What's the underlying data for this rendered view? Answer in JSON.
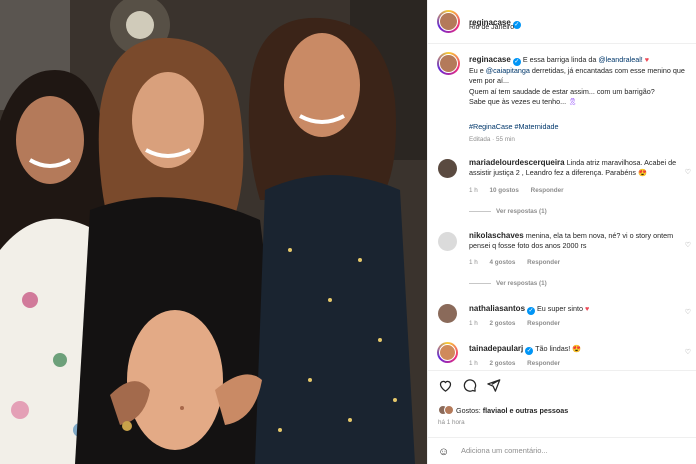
{
  "post": {
    "username": "reginacase",
    "location": "Rio de Janeiro"
  },
  "caption": {
    "username": "reginacase",
    "line1_pre": "E essa barriga linda da ",
    "mention1": "@leandraleal!",
    "line2_pre": "Eu e ",
    "mention2": "@caiapitanga",
    "line2_post": " derretidas, já encantadas com esse menino que vem por aí...",
    "line3": "Quem aí tem saudade de estar assim... com um barrigão?",
    "line4": "Sabe que às vezes eu tenho...",
    "hashtags": "#ReginaCase #Maternidade",
    "meta": "Editada · 55 min"
  },
  "comments": [
    {
      "username": "mariadelourdescerqueira",
      "text": "Linda atriz maravilhosa. Acabei de assistir justiça 2 , Leandro fez a diferença. Parabéns",
      "time": "1 h",
      "likes": "10 gostos",
      "reply": "Responder",
      "replies": "Ver respostas (1)"
    },
    {
      "username": "nikolaschaves",
      "text": "menina, ela ta bem nova, né? vi o story ontem pensei q fosse foto dos anos 2000 rs",
      "time": "1 h",
      "likes": "4 gostos",
      "reply": "Responder",
      "replies": "Ver respostas (1)"
    },
    {
      "username": "nathaliasantos",
      "text": "Eu super sinto",
      "time": "1 h",
      "likes": "2 gostos",
      "reply": "Responder"
    },
    {
      "username": "tainadepaularj",
      "text": "Tão lindas!",
      "time": "1 h",
      "likes": "2 gostos",
      "reply": "Responder"
    }
  ],
  "footer": {
    "likes_prefix": "Gostos: ",
    "likes_user": "flaviaol",
    "likes_suffix": " e outras pessoas",
    "time_ago": "há 1 hora",
    "comment_placeholder": "Adiciona um comentário..."
  },
  "icons": {
    "like": "heart-icon",
    "comment": "comment-icon",
    "share": "send-icon",
    "emoji": "emoji-icon",
    "verified": "verified-badge-icon"
  },
  "colors": {
    "link": "#00376b",
    "verified": "#0095f6",
    "heart": "#ed4956",
    "muted": "#8e8e8e"
  }
}
